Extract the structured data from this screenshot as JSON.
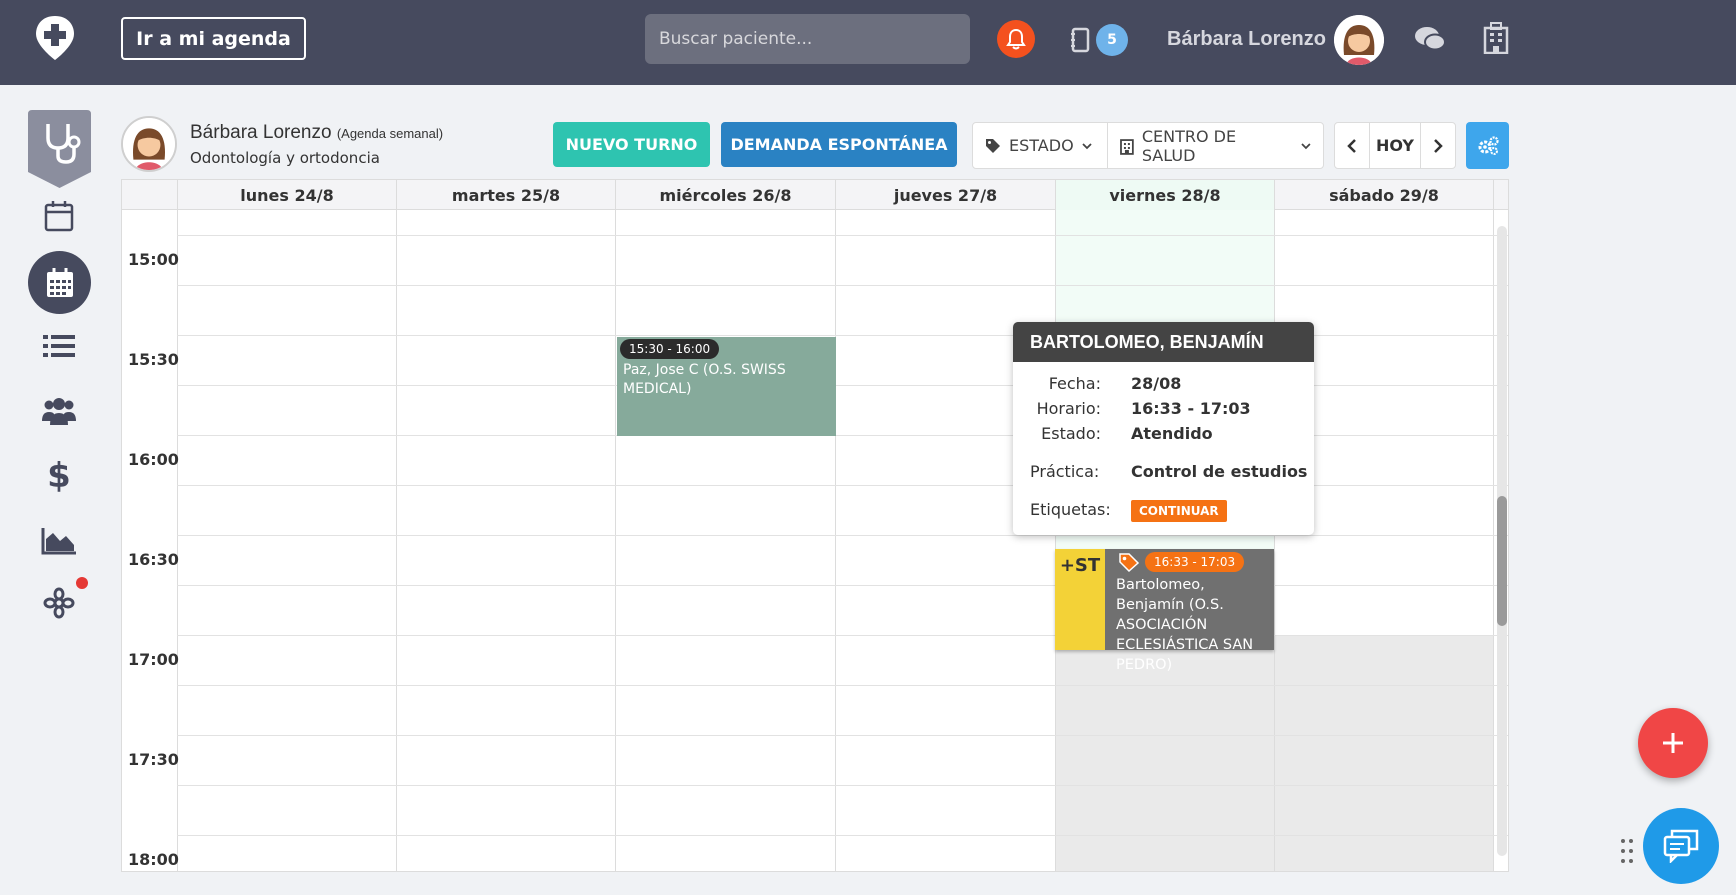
{
  "topbar": {
    "agenda_button": "Ir a mi agenda",
    "search_placeholder": "Buscar paciente...",
    "badge_count": "5",
    "user_name": "Bárbara Lorenzo"
  },
  "doctor": {
    "name": "Bárbara Lorenzo",
    "view": "(Agenda semanal)",
    "specialty": "Odontología y ortodoncia"
  },
  "toolbar": {
    "new_button": "NUEVO TURNO",
    "spontaneous_button": "DEMANDA ESPONTÁNEA",
    "status_filter": "ESTADO",
    "center_filter": "CENTRO DE SALUD",
    "today_button": "HOY"
  },
  "calendar": {
    "days": [
      "lunes 24/8",
      "martes 25/8",
      "miércoles 26/8",
      "jueves 27/8",
      "viernes 28/8",
      "sábado 29/8"
    ],
    "times": [
      "15:00",
      "15:30",
      "16:00",
      "16:30",
      "17:00",
      "17:30",
      "18:00"
    ],
    "events": [
      {
        "time": "15:30 - 16:00",
        "name": "Paz, Jose C (O.S. SWISS MEDICAL)"
      },
      {
        "prefix": "+ST",
        "time": "16:33 - 17:03",
        "name": "Bartolomeo, Benjamín (O.S. ASOCIACIÓN ECLESIÁSTICA SAN PEDRO)"
      }
    ]
  },
  "popover": {
    "title": "BARTOLOMEO, BENJAMÍN",
    "date_label": "Fecha:",
    "date_value": "28/08",
    "time_label": "Horario:",
    "time_value": "16:33 - 17:03",
    "status_label": "Estado:",
    "status_value": "Atendido",
    "practice_label": "Práctica:",
    "practice_value": "Control de estudios",
    "tags_label": "Etiquetas:",
    "tag": "CONTINUAR"
  },
  "colors": {
    "topbar": "#464a5e",
    "teal": "#2ec4b0",
    "blue": "#2a82c3",
    "orange": "#f57214",
    "red": "#f04646"
  }
}
